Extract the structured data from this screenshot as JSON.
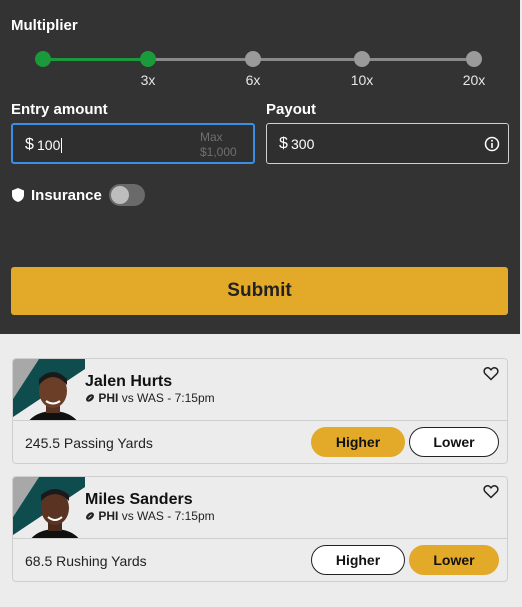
{
  "multiplier": {
    "label": "Multiplier",
    "ticks": [
      "3x",
      "6x",
      "10x",
      "20x"
    ],
    "selected": "3x"
  },
  "entry": {
    "label": "Entry amount",
    "currency": "$",
    "value": "100",
    "max_line1": "Max",
    "max_line2": "$1,000"
  },
  "payout": {
    "label": "Payout",
    "currency": "$",
    "value": "300"
  },
  "insurance": {
    "label": "Insurance",
    "enabled": false
  },
  "submit_label": "Submit",
  "picks": [
    {
      "player": "Jalen Hurts",
      "team": "PHI",
      "matchup": "vs WAS - 7:15pm",
      "line": "245.5 Passing Yards",
      "higher_label": "Higher",
      "lower_label": "Lower",
      "selected": "higher"
    },
    {
      "player": "Miles Sanders",
      "team": "PHI",
      "matchup": "vs WAS - 7:15pm",
      "line": "68.5 Rushing Yards",
      "higher_label": "Higher",
      "lower_label": "Lower",
      "selected": "lower"
    }
  ],
  "colors": {
    "panel": "#333333",
    "accent_green": "#1a9a3b",
    "submit_gold": "#e3a928",
    "focus_blue": "#3a8ee6",
    "team_teal": "#0e4c4d"
  }
}
